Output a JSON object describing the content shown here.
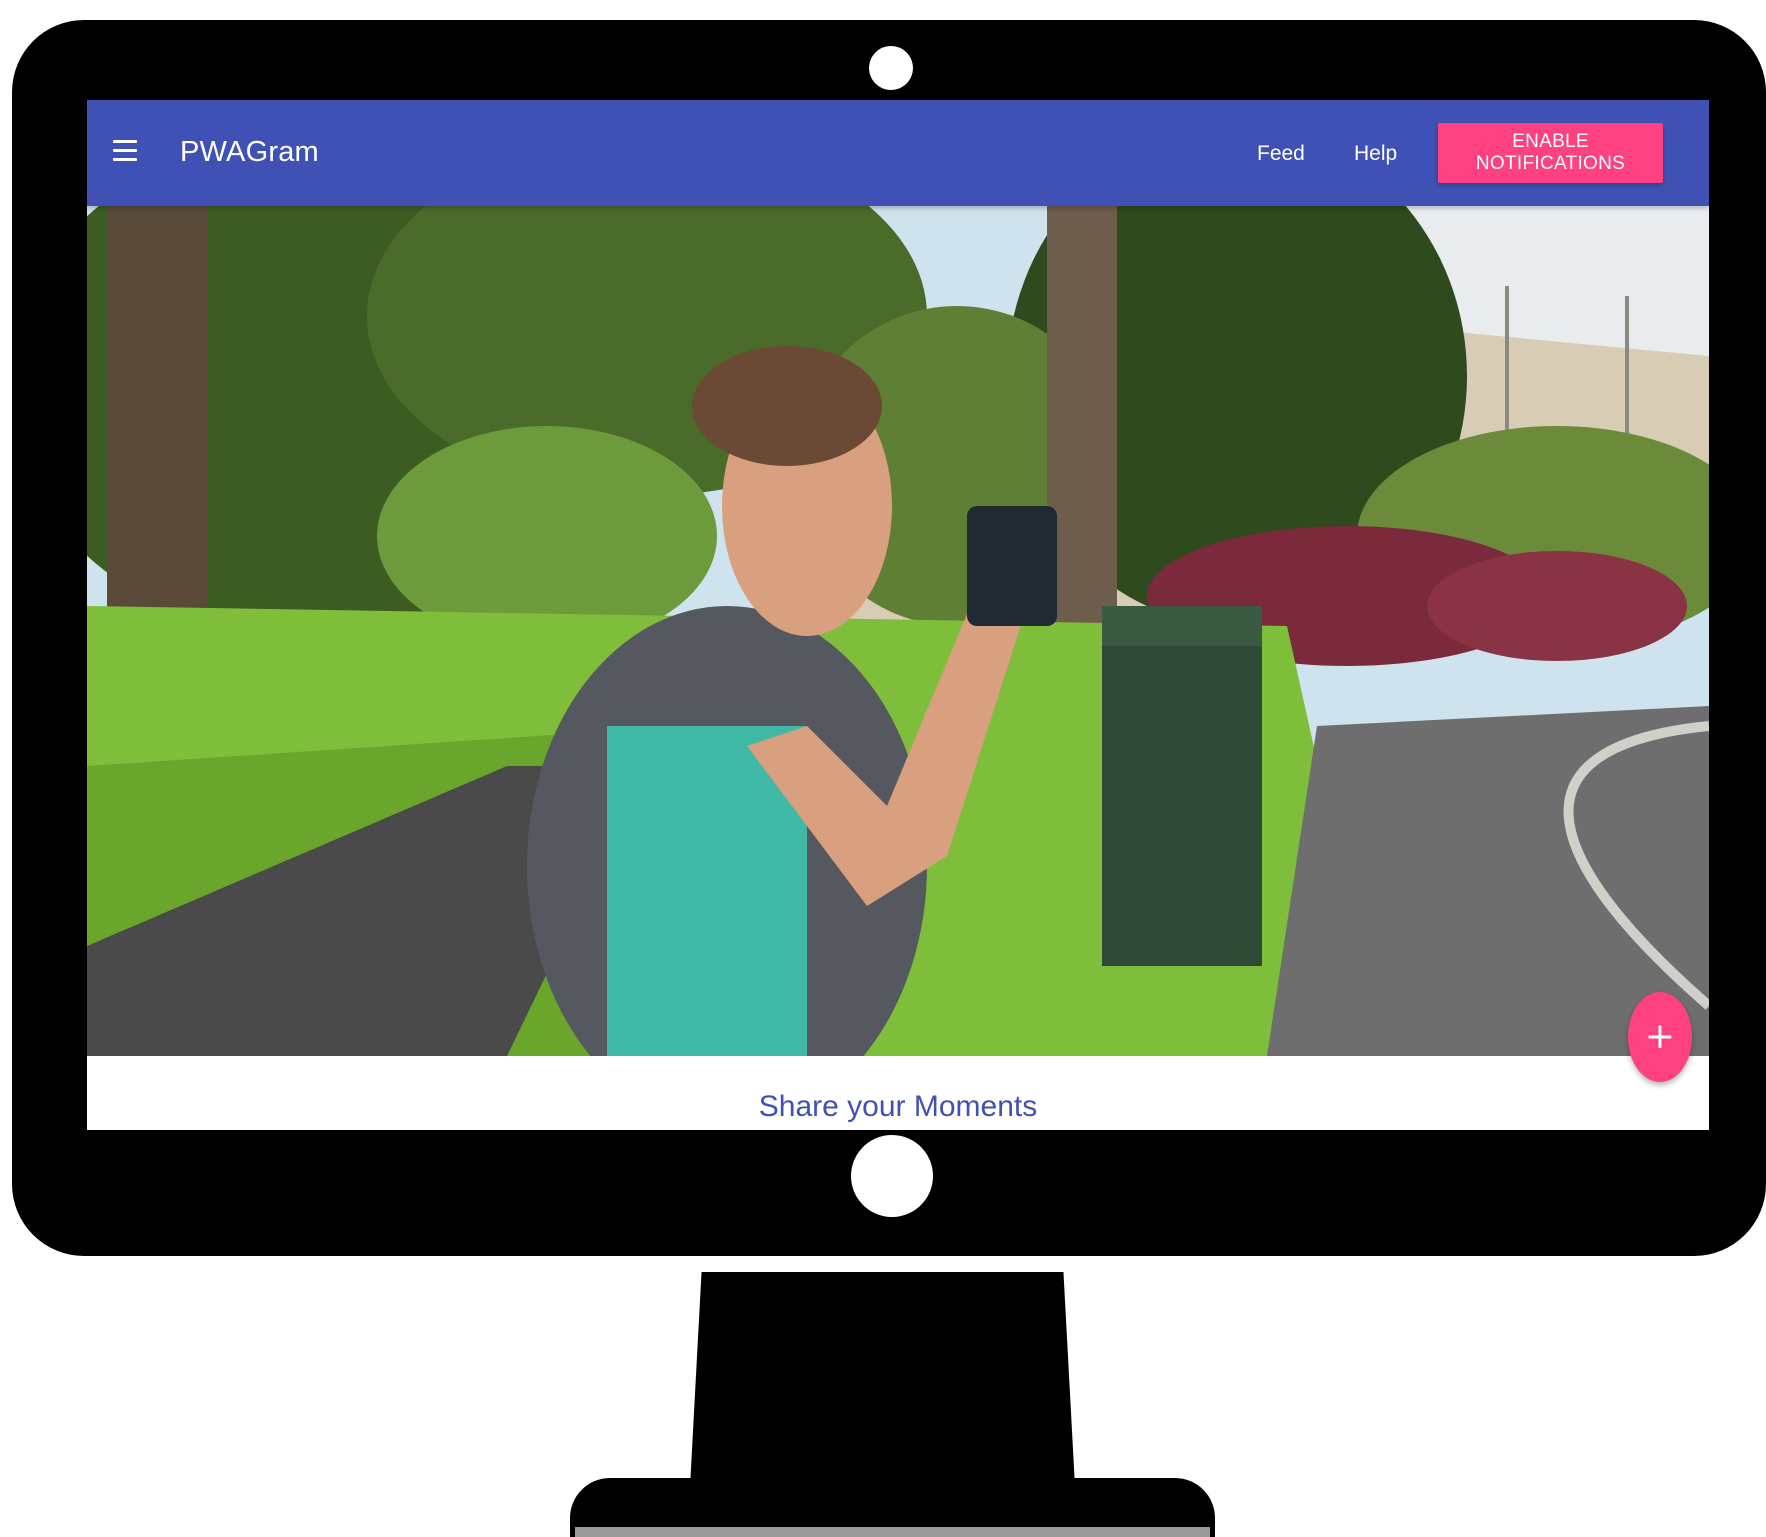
{
  "app": {
    "title": "PWAGram"
  },
  "nav": {
    "feed_label": "Feed",
    "help_label": "Help",
    "notifications_button_label": "ENABLE NOTIFICATIONS"
  },
  "main": {
    "heading": "Share your Moments",
    "fab_label": "+"
  },
  "icons": {
    "menu": "hamburger-menu-icon",
    "fab": "plus-icon"
  },
  "colors": {
    "primary": "#3f51b5",
    "accent": "#ff4081",
    "bezel": "#000000"
  }
}
